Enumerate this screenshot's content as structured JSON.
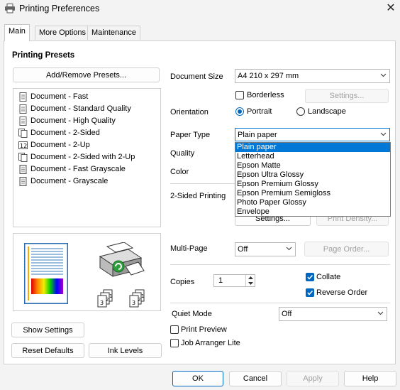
{
  "window": {
    "title": "Printing Preferences"
  },
  "tabs": [
    {
      "label": "Main"
    },
    {
      "label": "More Options"
    },
    {
      "label": "Maintenance"
    }
  ],
  "presets": {
    "heading": "Printing Presets",
    "add_remove_label": "Add/Remove Presets...",
    "items": [
      {
        "label": "Document - Fast"
      },
      {
        "label": "Document - Standard Quality"
      },
      {
        "label": "Document - High Quality"
      },
      {
        "label": "Document - 2-Sided"
      },
      {
        "label": "Document - 2-Up"
      },
      {
        "label": "Document - 2-Sided with 2-Up"
      },
      {
        "label": "Document - Fast Grayscale"
      },
      {
        "label": "Document - Grayscale"
      }
    ]
  },
  "left_buttons": {
    "show_settings": "Show Settings",
    "reset_defaults": "Reset Defaults",
    "ink_levels": "Ink Levels"
  },
  "form": {
    "document_size_label": "Document Size",
    "document_size_value": "A4 210 x 297 mm",
    "borderless_label": "Borderless",
    "settings_label": "Settings...",
    "orientation_label": "Orientation",
    "portrait_label": "Portrait",
    "landscape_label": "Landscape",
    "paper_type_label": "Paper Type",
    "paper_type_value": "Plain paper",
    "quality_label": "Quality",
    "color_label": "Color",
    "two_sided_label": "2-Sided Printing",
    "two_sided_settings_label": "Settings...",
    "print_density_label": "Print Density...",
    "multipage_label": "Multi-Page",
    "multipage_value": "Off",
    "page_order_label": "Page Order...",
    "copies_label": "Copies",
    "copies_value": "1",
    "collate_label": "Collate",
    "reverse_order_label": "Reverse Order",
    "quiet_mode_label": "Quiet Mode",
    "quiet_mode_value": "Off",
    "print_preview_label": "Print Preview",
    "job_arranger_label": "Job Arranger Lite"
  },
  "paper_type_options": [
    "Plain paper",
    "Letterhead",
    "Epson Matte",
    "Epson Ultra Glossy",
    "Epson Premium Glossy",
    "Epson Premium Semigloss",
    "Photo Paper Glossy",
    "Envelope"
  ],
  "footer": {
    "ok": "OK",
    "cancel": "Cancel",
    "apply": "Apply",
    "help": "Help"
  },
  "colors": {
    "accent": "#0067c0",
    "selection": "#0078d7"
  }
}
